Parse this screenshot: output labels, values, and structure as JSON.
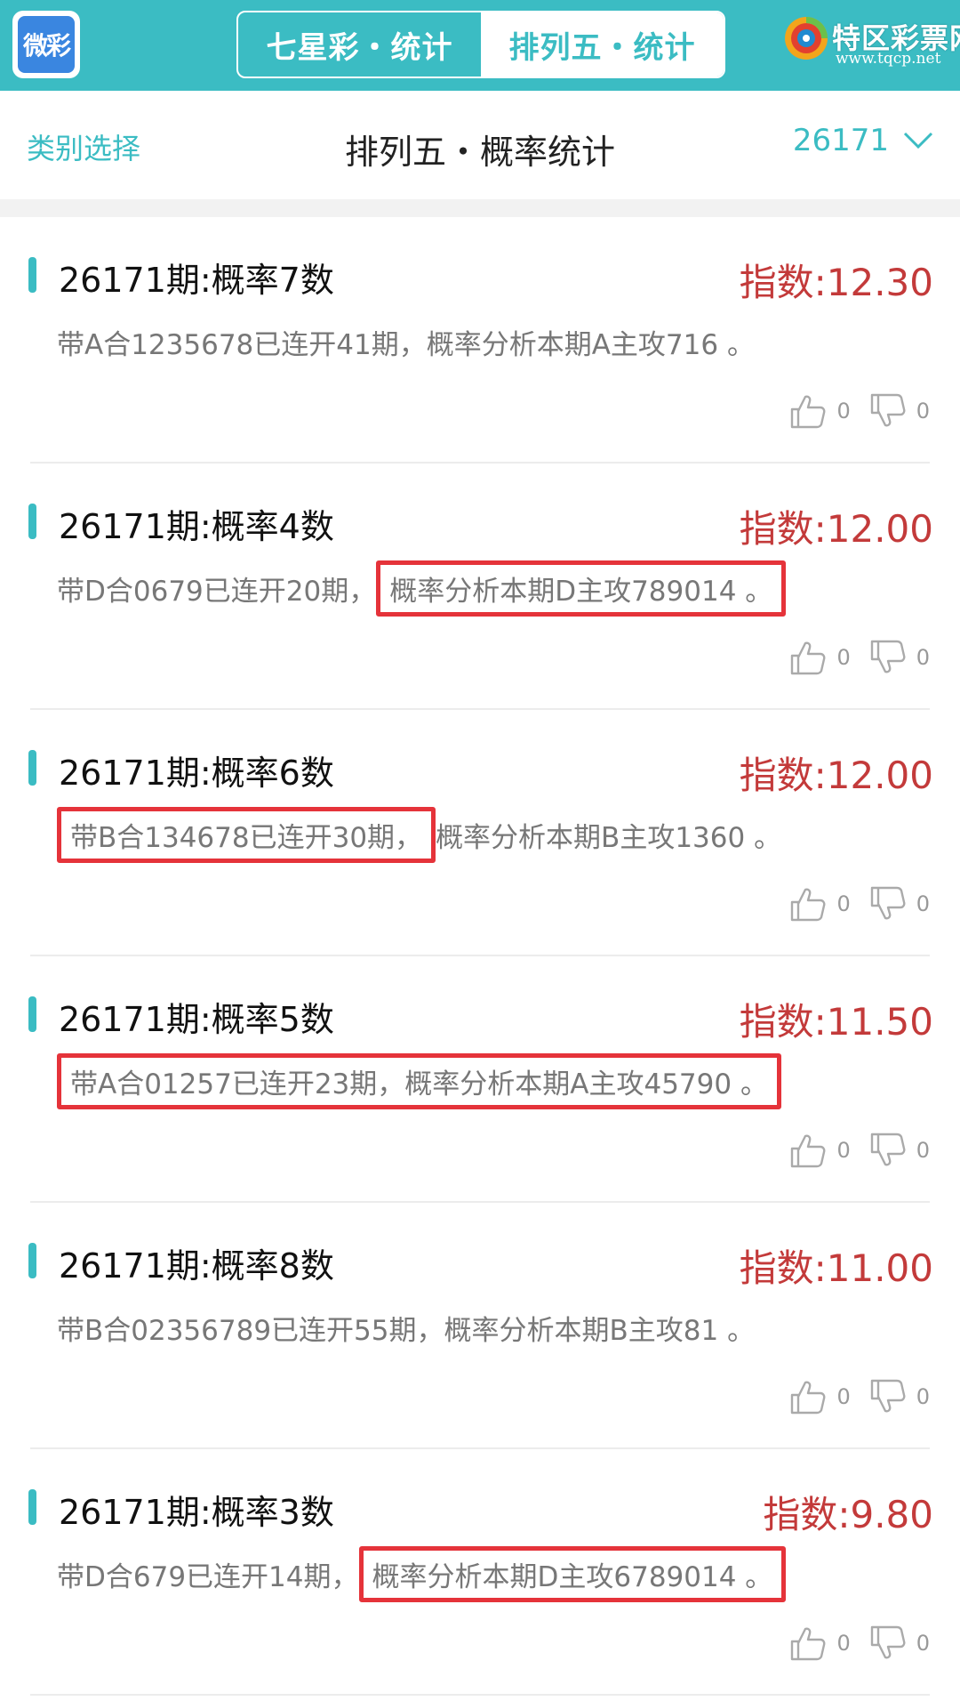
{
  "header": {
    "logo_text": "微彩",
    "tabs": [
      {
        "label": "七星彩・统计",
        "active": false
      },
      {
        "label": "排列五・统计",
        "active": true
      }
    ],
    "brand_name": "特区彩票网",
    "brand_url": "www.tqcp.net"
  },
  "subheader": {
    "category_label": "类别选择",
    "title": "排列五・概率统计",
    "issue": "26171"
  },
  "colors": {
    "accent": "#3bbcc3",
    "index_red": "#c33a3a",
    "highlight_red": "#e5333a"
  },
  "items": [
    {
      "title": "26171期:概率7数",
      "index": "指数:12.30",
      "desc_a": "带A合1235678已连开41期，概率分析本期A主攻716 。",
      "desc_b": "",
      "highlight": "none",
      "likes": "0",
      "dislikes": "0"
    },
    {
      "title": "26171期:概率4数",
      "index": "指数:12.00",
      "desc_a": "带D合0679已连开20期，",
      "desc_b": "概率分析本期D主攻789014 。",
      "highlight": "second",
      "likes": "0",
      "dislikes": "0"
    },
    {
      "title": "26171期:概率6数",
      "index": "指数:12.00",
      "desc_a": "带B合134678已连开30期，",
      "desc_b": "概率分析本期B主攻1360 。",
      "highlight": "first",
      "likes": "0",
      "dislikes": "0"
    },
    {
      "title": "26171期:概率5数",
      "index": "指数:11.50",
      "desc_a": "带A合01257已连开23期，概率分析本期A主攻45790 。",
      "desc_b": "",
      "highlight": "all",
      "likes": "0",
      "dislikes": "0"
    },
    {
      "title": "26171期:概率8数",
      "index": "指数:11.00",
      "desc_a": "带B合02356789已连开55期，概率分析本期B主攻81 。",
      "desc_b": "",
      "highlight": "none",
      "likes": "0",
      "dislikes": "0"
    },
    {
      "title": "26171期:概率3数",
      "index": "指数:9.80",
      "desc_a": "带D合679已连开14期，",
      "desc_b": "概率分析本期D主攻6789014 。",
      "highlight": "second",
      "likes": "0",
      "dislikes": "0"
    }
  ]
}
